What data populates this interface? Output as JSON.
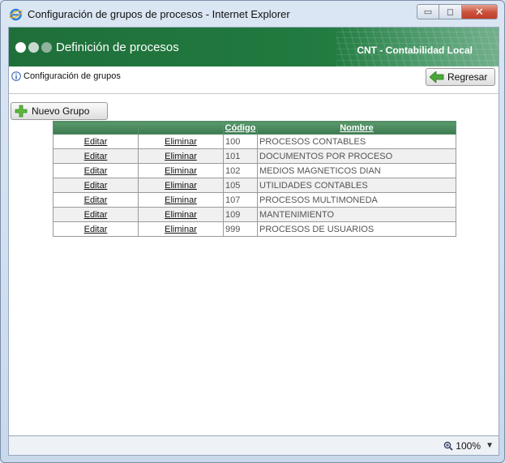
{
  "window": {
    "title": "Configuración de grupos de procesos - Internet Explorer",
    "min_label": "▭",
    "max_label": "◻",
    "close_label": "✕"
  },
  "banner": {
    "title": "Definición de procesos",
    "right_text": "CNT - Contabilidad Local"
  },
  "subbar": {
    "label": "Configuración de grupos",
    "back_label": "Regresar"
  },
  "toolbar": {
    "new_group_label": "Nuevo Grupo"
  },
  "table": {
    "headers": [
      "",
      "",
      "Código",
      "Nombre"
    ],
    "edit_label": "Editar",
    "delete_label": "Eliminar",
    "rows": [
      {
        "code": "100",
        "name": "PROCESOS CONTABLES"
      },
      {
        "code": "101",
        "name": "DOCUMENTOS POR PROCESO"
      },
      {
        "code": "102",
        "name": "MEDIOS MAGNETICOS DIAN"
      },
      {
        "code": "105",
        "name": "UTILIDADES CONTABLES"
      },
      {
        "code": "107",
        "name": "PROCESOS MULTIMONEDA"
      },
      {
        "code": "109",
        "name": "MANTENIMIENTO"
      },
      {
        "code": "999",
        "name": "PROCESOS DE USUARIOS"
      }
    ]
  },
  "status": {
    "zoom": "100%"
  },
  "colors": {
    "banner_green": "#217a3f",
    "header_green": "#4a8a5e"
  }
}
